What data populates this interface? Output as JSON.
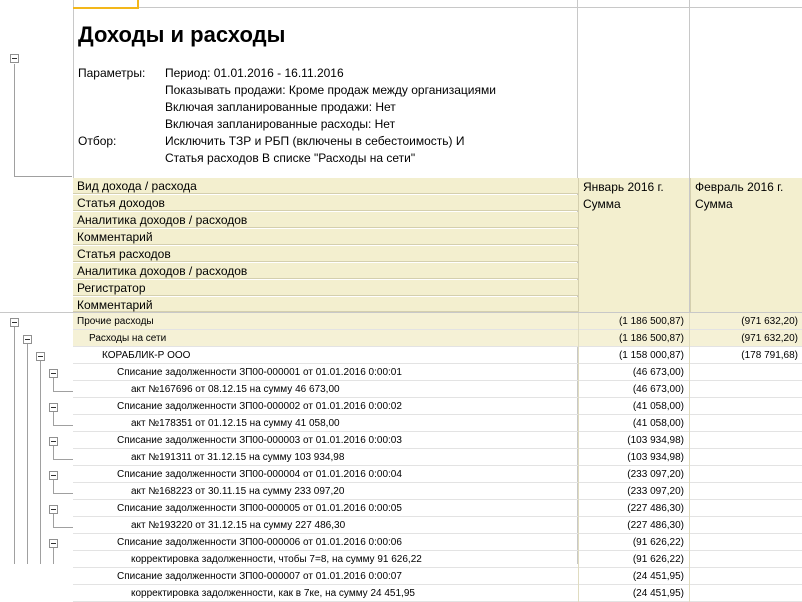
{
  "report": {
    "title": "Доходы и расходы",
    "parameters_label": "Параметры:",
    "parameters": [
      "Период: 01.01.2016 - 16.11.2016",
      "Показывать продажи: Кроме продаж между организациями",
      "Включая запланированные продажи: Нет",
      "Включая запланированные расходы: Нет"
    ],
    "filter_label": "Отбор:",
    "filter": [
      "Исключить ТЗР и РБП (включены в себестоимость) И",
      "Статья расходов В списке \"Расходы на сети\""
    ]
  },
  "header": {
    "groupings": [
      "Вид дохода / расхода",
      "Статья доходов",
      "Аналитика доходов / расходов",
      "Комментарий",
      "Статья расходов",
      "Аналитика доходов / расходов",
      "Регистратор",
      "Комментарий"
    ],
    "columns": [
      {
        "period": "Январь 2016 г.",
        "measure": "Сумма"
      },
      {
        "period": "Февраль 2016 г.",
        "measure": "Сумма"
      }
    ]
  },
  "rows": [
    {
      "label": "Прочие расходы",
      "jan": "(1 186 500,87)",
      "feb": "(971 632,20)"
    },
    {
      "label": "Расходы на сети",
      "jan": "(1 186 500,87)",
      "feb": "(971 632,20)"
    },
    {
      "label": "КОРАБЛИК-Р ООО",
      "jan": "(1 158 000,87)",
      "feb": "(178 791,68)"
    },
    {
      "label": "Списание задолженности ЗП00-000001 от 01.01.2016 0:00:01",
      "jan": "(46 673,00)",
      "feb": ""
    },
    {
      "label": "акт №167696 от 08.12.15 на сумму 46 673,00",
      "jan": "(46 673,00)",
      "feb": ""
    },
    {
      "label": "Списание задолженности ЗП00-000002 от 01.01.2016 0:00:02",
      "jan": "(41 058,00)",
      "feb": ""
    },
    {
      "label": "акт №178351 от 01.12.15 на сумму 41 058,00",
      "jan": "(41 058,00)",
      "feb": ""
    },
    {
      "label": "Списание задолженности ЗП00-000003 от 01.01.2016 0:00:03",
      "jan": "(103 934,98)",
      "feb": ""
    },
    {
      "label": "акт №191311 от 31.12.15 на сумму 103 934,98",
      "jan": "(103 934,98)",
      "feb": ""
    },
    {
      "label": "Списание задолженности ЗП00-000004 от 01.01.2016 0:00:04",
      "jan": "(233 097,20)",
      "feb": ""
    },
    {
      "label": "акт №168223 от 30.11.15 на сумму 233 097,20",
      "jan": "(233 097,20)",
      "feb": ""
    },
    {
      "label": "Списание задолженности ЗП00-000005 от 01.01.2016 0:00:05",
      "jan": "(227 486,30)",
      "feb": ""
    },
    {
      "label": "акт №193220 от 31.12.15 на сумму 227 486,30",
      "jan": "(227 486,30)",
      "feb": ""
    },
    {
      "label": "Списание задолженности ЗП00-000006 от 01.01.2016 0:00:06",
      "jan": "(91 626,22)",
      "feb": ""
    },
    {
      "label": "корректировка задолженности, чтобы 7=8, на сумму 91 626,22",
      "jan": "(91 626,22)",
      "feb": ""
    },
    {
      "label": "Списание задолженности ЗП00-000007 от 01.01.2016 0:00:07",
      "jan": "(24 451,95)",
      "feb": ""
    },
    {
      "label": "корректировка задолженности, как в 7ке, на сумму 24 451,95",
      "jan": "(24 451,95)",
      "feb": ""
    }
  ]
}
